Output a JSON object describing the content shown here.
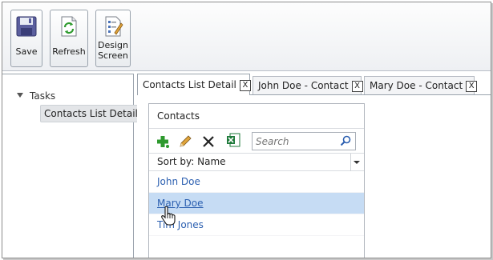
{
  "toolbar": {
    "save_label": "Save",
    "refresh_label": "Refresh",
    "design_label_line1": "Design",
    "design_label_line2": "Screen"
  },
  "nav": {
    "group_label": "Tasks",
    "items": [
      {
        "label": "Contacts List Detail",
        "selected": true
      }
    ]
  },
  "tabs": [
    {
      "label": "Contacts List Detail",
      "close": "X",
      "active": true
    },
    {
      "label": "John Doe - Contact",
      "close": "X",
      "active": false
    },
    {
      "label": "Mary Doe - Contact",
      "close": "X",
      "active": false
    }
  ],
  "contacts": {
    "title": "Contacts",
    "search_placeholder": "Search",
    "sort_label": "Sort by: Name",
    "rows": [
      {
        "name": "John Doe",
        "selected": false
      },
      {
        "name": "Mary Doe",
        "selected": true
      },
      {
        "name": "Tim Jones",
        "selected": false
      }
    ]
  },
  "icons": {
    "save": "floppy-disk-icon",
    "refresh": "refresh-document-icon",
    "design": "design-screen-icon",
    "add": "add-icon",
    "edit": "edit-pencil-icon",
    "delete": "delete-x-icon",
    "excel": "export-excel-icon",
    "search": "magnifier-icon",
    "cursor": "hand-pointer-icon"
  },
  "colors": {
    "link": "#2b5fb0",
    "selected_row": "#c6dcf4",
    "add_green": "#2e9a2e",
    "excel_green": "#1e7a3a"
  }
}
